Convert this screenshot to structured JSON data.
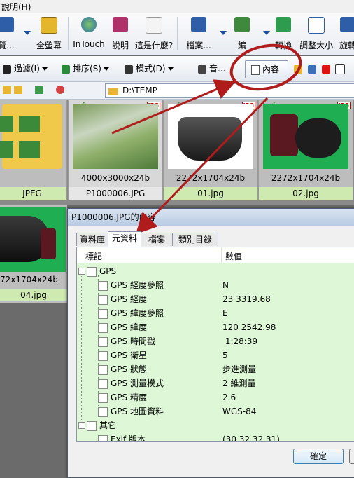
{
  "menubar": {
    "help_label": "說明(H)"
  },
  "toolbar": {
    "browse_label": "覽...",
    "fullscreen_label": "全螢幕",
    "intouch_label": "InTouch",
    "help_label": "說明",
    "whatsthis_label": "這是什麼?",
    "file_label": "檔案...",
    "edit_label": "編",
    "convert_label": "轉換",
    "resize_label": "調整大小",
    "rotate_label": "旋轉"
  },
  "toolbar2": {
    "filter_label": "過濾(I)",
    "sort_label": "排序(S)",
    "mode_label": "模式(D)",
    "audio_label": "音...",
    "content_label": "內容"
  },
  "address": {
    "path": "D:\\TEMP"
  },
  "thumbnails": [
    {
      "dims": "",
      "name": "JPEG"
    },
    {
      "dims": "4000x3000x24b",
      "name": "P1000006.JPG"
    },
    {
      "dims": "2272x1704x24b",
      "name": "01.jpg"
    },
    {
      "dims": "2272x1704x24b",
      "name": "02.jpg"
    },
    {
      "dims": "72x1704x24b",
      "name": "04.jpg"
    }
  ],
  "badges": {
    "jpg": "JPG",
    "info": "i"
  },
  "dialog": {
    "title": "P1000006.JPG的內容",
    "tabs": [
      "資料庫",
      "元資料",
      "檔案",
      "類別目錄"
    ],
    "active_tab": "元資料",
    "col_tag": "標記",
    "col_value": "數值",
    "groups": [
      {
        "name": "GPS",
        "rows": [
          {
            "key": "GPS 經度參照",
            "value": "N"
          },
          {
            "key": "GPS 經度",
            "value": "23 3319.68"
          },
          {
            "key": "GPS 緯度參照",
            "value": "E"
          },
          {
            "key": "GPS 緯度",
            "value": "120 2542.98"
          },
          {
            "key": "GPS 時間戳",
            "value": " 1:28:39"
          },
          {
            "key": "GPS 衛星",
            "value": "5"
          },
          {
            "key": "GPS 狀態",
            "value": "步進測量"
          },
          {
            "key": "GPS 測量模式",
            "value": "2 維測量"
          },
          {
            "key": "GPS 精度",
            "value": "2.6"
          },
          {
            "key": "GPS 地圖資料",
            "value": "WGS-84"
          }
        ]
      },
      {
        "name": "其它",
        "rows": [
          {
            "key": "Exif 版本",
            "value": "(30.32.32.31)"
          }
        ]
      }
    ],
    "ok_label": "確定"
  },
  "colors": {
    "accent": "#1e4f9c",
    "tree_bg": "#ddf7d7",
    "annotation_arrow": "#b01c1c"
  }
}
